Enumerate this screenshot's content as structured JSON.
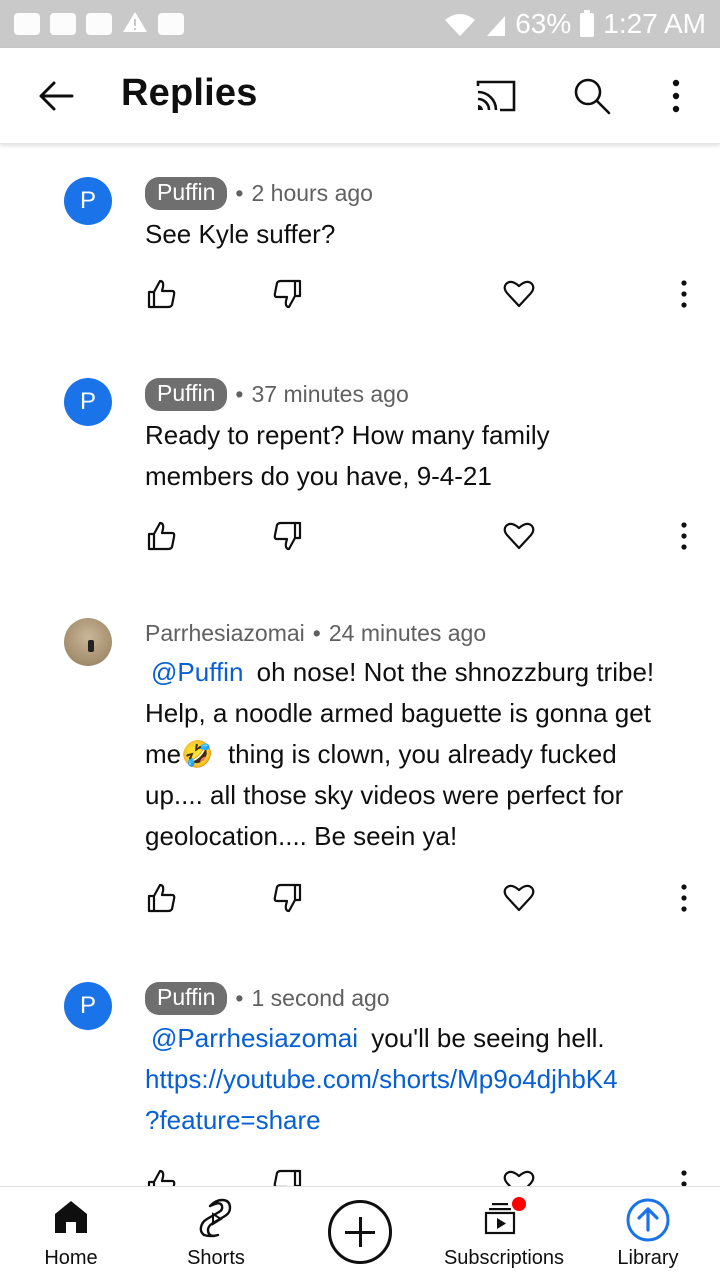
{
  "status_bar": {
    "battery": "63%",
    "time": "1:27 AM",
    "icons": [
      "message-icon",
      "youtube-icon",
      "folder-icon",
      "warning-icon",
      "image-icon",
      "wifi-icon",
      "signal-icon",
      "battery-icon"
    ]
  },
  "header": {
    "title": "Replies",
    "icons": [
      "back-arrow-icon",
      "cast-icon",
      "search-icon",
      "more-vert-icon"
    ]
  },
  "comments": [
    {
      "avatar_letter": "P",
      "author": "Puffin",
      "author_style": "chip",
      "time": "2 hours ago",
      "mention": "",
      "lines": [
        "See Kyle suffer?"
      ]
    },
    {
      "avatar_letter": "P",
      "author": "Puffin",
      "author_style": "chip",
      "time": "37 minutes ago",
      "mention": "",
      "lines": [
        "Ready to repent? How many family",
        "members do you have, 9-4-21"
      ]
    },
    {
      "avatar_letter": "",
      "author": "Parrhesiazomai",
      "author_style": "plain",
      "time": "24 minutes ago",
      "mention": "@Puffin",
      "text_after_mention": "oh nose! Not the shnozzburg tribe!",
      "line2": "Help, a noodle armed baguette is gonna get",
      "line3_pre": "me",
      "emoji": "🤣",
      "line3_post": "thing is clown, you already fucked",
      "line4": "up.... all those sky videos were perfect for",
      "line5": "geolocation.... Be seein ya!"
    },
    {
      "avatar_letter": "P",
      "author": "Puffin",
      "author_style": "chip",
      "time": "1 second ago",
      "mention": "@Parrhesiazomai",
      "text_after_mention": "you'll be seeing hell.",
      "link_line1": "https://youtube.com/shorts/Mp9o4djhbK4",
      "link_line2": "?feature=share"
    }
  ],
  "bottom_nav": {
    "home": "Home",
    "shorts": "Shorts",
    "subscriptions": "Subscriptions",
    "library": "Library"
  },
  "colors": {
    "accent_link": "#065fd4",
    "avatar_blue": "#1a73e8",
    "notification_dot": "#ff0000"
  }
}
